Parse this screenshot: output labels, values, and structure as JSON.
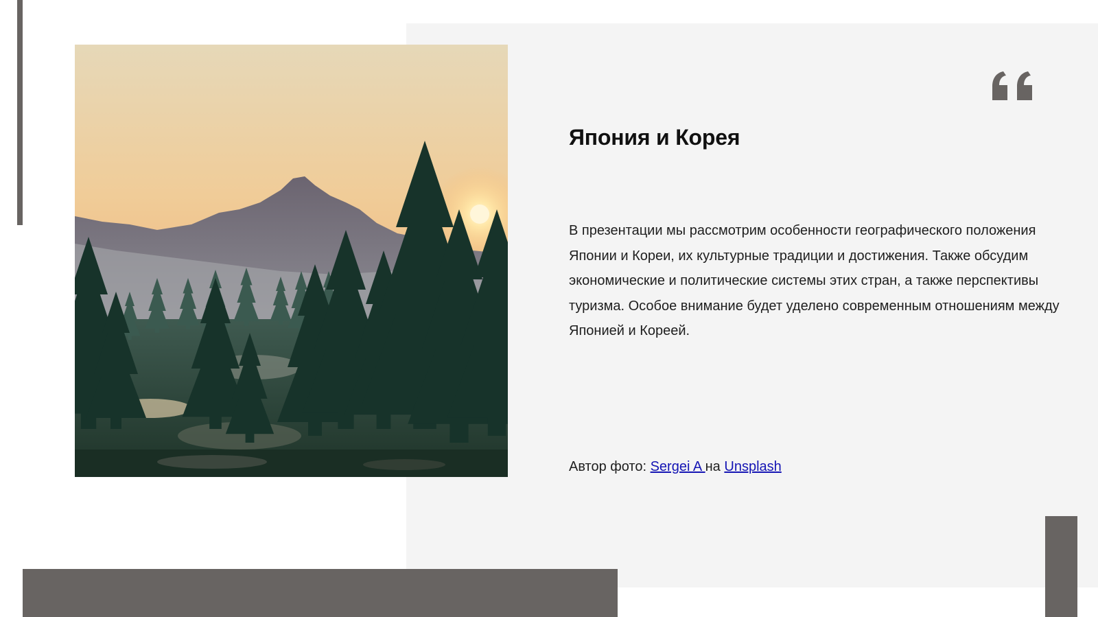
{
  "slide": {
    "title": "Япония и Корея",
    "body": "В презентации мы рассмотрим особенности географического положения Японии и Кореи, их культурные традиции и достижения. Также обсудим экономические и политические системы этих стран, а также перспективы туризма. Особое внимание будет уделено современным отношениям между Японией и Кореей.",
    "credit": {
      "prefix": "Автор фото: ",
      "author": "Sergei A ",
      "middle": "на ",
      "site": "Unsplash "
    },
    "icons": {
      "quote": "quote-icon",
      "photo": "mountain-forest-sunset-photo"
    },
    "colors": {
      "accent": "#686462",
      "panel": "#f4f4f4",
      "link": "#1414b4"
    }
  }
}
